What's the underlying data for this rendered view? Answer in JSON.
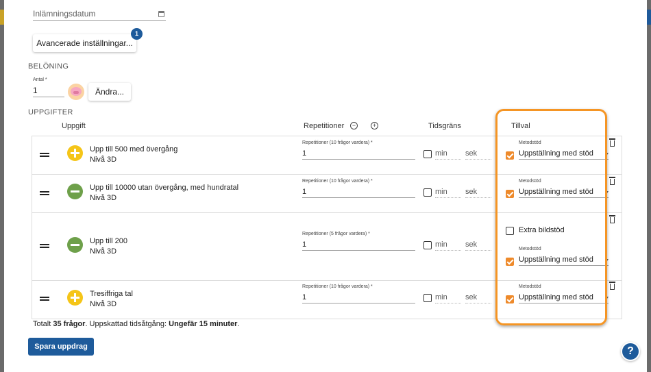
{
  "submission_date": {
    "placeholder": "Inlämningsdatum"
  },
  "advanced": {
    "label": "Avancerade inställningar...",
    "badge": "1"
  },
  "reward": {
    "title": "BELÖNING",
    "amount_label": "Antal *",
    "amount_value": "1",
    "change_label": "Ändra..."
  },
  "tasks": {
    "title": "UPPGIFTER",
    "columns": {
      "task": "Uppgift",
      "repetitions": "Repetitioner",
      "time_limit": "Tidsgräns",
      "options": "Tillval"
    },
    "decrease_icon": "minus-circle-icon",
    "increase_icon": "plus-circle-icon",
    "rows": [
      {
        "status": "plus",
        "name": "Upp till 500 med övergång",
        "level": "Nivå 3D",
        "rep_label": "Repetitioner (10 frågor vardera) *",
        "rep_value": "1",
        "min": "min",
        "sek": "sek",
        "method_label": "Metodstöd",
        "method_value": "Uppställning med stöd",
        "method_checked": true
      },
      {
        "status": "minus",
        "name": "Upp till 10000 utan övergång, med hundratal",
        "level": "Nivå 3D",
        "rep_label": "Repetitioner (10 frågor vardera) *",
        "rep_value": "1",
        "min": "min",
        "sek": "sek",
        "method_label": "Metodstöd",
        "method_value": "Uppställning med stöd",
        "method_checked": true
      },
      {
        "status": "minus",
        "name": "Upp till 200",
        "level": "Nivå 3D",
        "rep_label": "Repetitioner (5 frågor vardera) *",
        "rep_value": "1",
        "min": "min",
        "sek": "sek",
        "extra_label": "Extra bildstöd",
        "extra_checked": false,
        "method_label": "Metodstöd",
        "method_value": "Uppställning med stöd",
        "method_checked": true
      },
      {
        "status": "plus",
        "name": "Tresiffriga tal",
        "level": "Nivå 3D",
        "rep_label": "Repetitioner (10 frågor vardera) *",
        "rep_value": "1",
        "min": "min",
        "sek": "sek",
        "method_label": "Metodstöd",
        "method_value": "Uppställning med stöd",
        "method_checked": true
      }
    ]
  },
  "summary": {
    "prefix": "Totalt",
    "questions": "35 frågor",
    "middle": ". Uppskattad tidsåtgång:",
    "time": "Ungefär 15 minuter",
    "suffix": "."
  },
  "save_label": "Spara uppdrag",
  "help_label": "?",
  "colors": {
    "primary": "#1e5b9b",
    "highlight": "#f59524",
    "checkbox": "#ee8a2b",
    "plus": "#f5c518",
    "minus": "#6ea04a"
  }
}
